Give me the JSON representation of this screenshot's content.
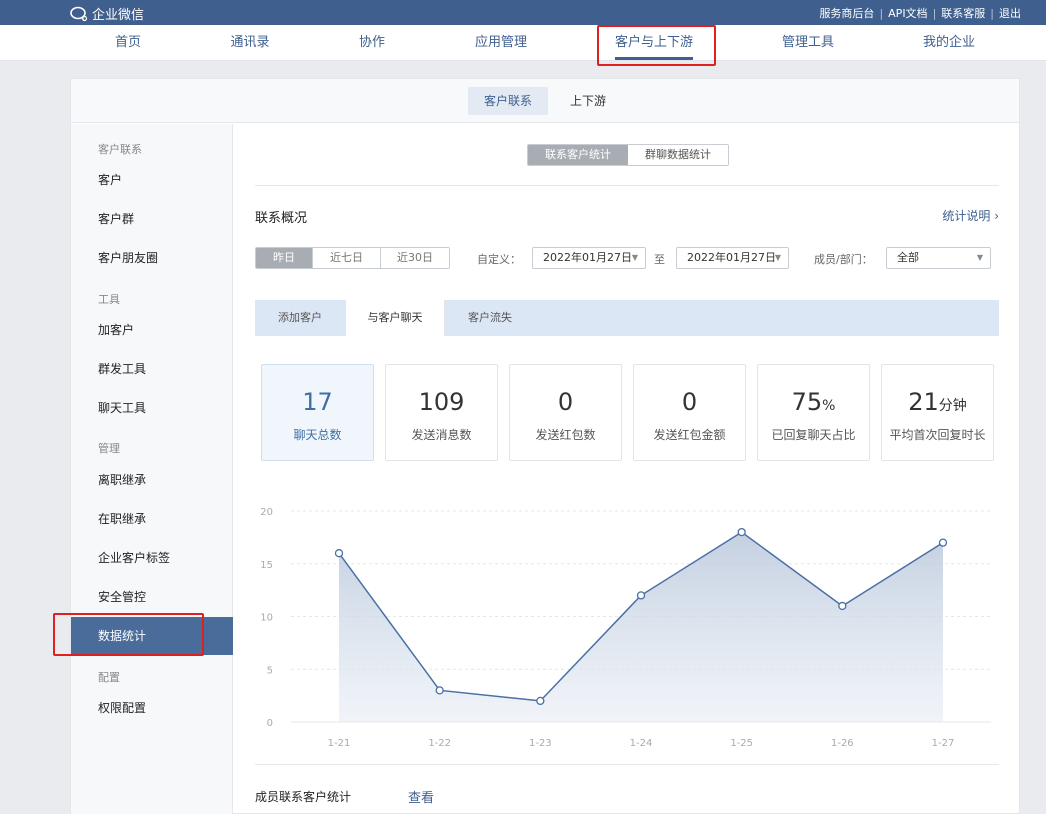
{
  "topbar": {
    "app_title": "企业微信",
    "links": [
      "服务商后台",
      "API文档",
      "联系客服",
      "退出"
    ]
  },
  "nav": {
    "items": [
      "首页",
      "通讯录",
      "协作",
      "应用管理",
      "客户与上下游",
      "管理工具",
      "我的企业"
    ],
    "active": "客户与上下游"
  },
  "subtabs": [
    "客户联系",
    "上下游"
  ],
  "sidebar": {
    "groups": [
      {
        "title": "客户联系",
        "items": [
          "客户",
          "客户群",
          "客户朋友圈"
        ]
      },
      {
        "title": "工具",
        "items": [
          "加客户",
          "群发工具",
          "聊天工具"
        ]
      },
      {
        "title": "管理",
        "items": [
          "离职继承",
          "在职继承",
          "企业客户标签",
          "安全管控",
          "数据统计"
        ]
      },
      {
        "title": "配置",
        "items": [
          "权限配置"
        ]
      }
    ],
    "active": "数据统计"
  },
  "main": {
    "toggle": [
      "联系客户统计",
      "群聊数据统计"
    ],
    "section_title": "联系概况",
    "help_link": "统计说明 ›",
    "range_buttons": [
      "昨日",
      "近七日",
      "近30日"
    ],
    "custom_label": "自定义：",
    "start_date": "2022年01月27日",
    "to_label": "至",
    "end_date": "2022年01月27日",
    "member_label": "成员/部门：",
    "member_value": "全部",
    "chat_tabs": [
      "添加客户",
      "与客户聊天",
      "客户流失"
    ],
    "stats": [
      {
        "value": "17",
        "unit": "",
        "label": "聊天总数"
      },
      {
        "value": "109",
        "unit": "",
        "label": "发送消息数"
      },
      {
        "value": "0",
        "unit": "",
        "label": "发送红包数"
      },
      {
        "value": "0",
        "unit": "",
        "label": "发送红包金额"
      },
      {
        "value": "75",
        "unit": "%",
        "label": "已回复聊天占比"
      },
      {
        "value": "21",
        "unit": "分钟",
        "label": "平均首次回复时长"
      }
    ],
    "bottom_title": "成员联系客户统计",
    "bottom_link": "查看"
  },
  "chart_data": {
    "type": "area",
    "categories": [
      "1-21",
      "1-22",
      "1-23",
      "1-24",
      "1-25",
      "1-26",
      "1-27"
    ],
    "values": [
      16,
      3,
      2,
      12,
      18,
      11,
      17
    ],
    "ylim": [
      0,
      20
    ],
    "yticks": [
      0,
      5,
      10,
      15,
      20
    ],
    "grid": true,
    "line_color": "#4a6fa5"
  }
}
